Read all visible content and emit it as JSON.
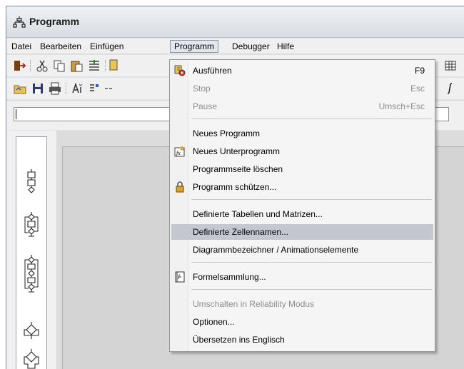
{
  "window": {
    "title": "Programm"
  },
  "menubar": {
    "items": [
      {
        "label": "Datei"
      },
      {
        "label": "Bearbeiten"
      },
      {
        "label": "Einfügen"
      },
      {
        "label": "Programm"
      },
      {
        "label": "Debugger"
      },
      {
        "label": "Hilfe"
      }
    ]
  },
  "menu": {
    "open_menu": "Programm",
    "items": [
      {
        "label": "Ausführen",
        "shortcut": "F9",
        "icon": "run-icon",
        "enabled": true
      },
      {
        "label": "Stop",
        "shortcut": "Esc",
        "enabled": false
      },
      {
        "label": "Pause",
        "shortcut": "Umsch+Esc",
        "enabled": false
      },
      {
        "label": "Neues Programm",
        "enabled": true
      },
      {
        "label": "Neues Unterprogramm",
        "icon": "fx-icon",
        "enabled": true
      },
      {
        "label": "Programmseite löschen",
        "enabled": true
      },
      {
        "label": "Programm schützen...",
        "icon": "lock-icon",
        "enabled": true
      },
      {
        "label": "Definierte Tabellen und Matrizen...",
        "enabled": true
      },
      {
        "label": "Definierte Zellennamen...",
        "enabled": true,
        "highlighted": true
      },
      {
        "label": "Diagrammbezeichner / Animationselemente",
        "enabled": true
      },
      {
        "label": "Formelsammlung...",
        "icon": "formula-book-icon",
        "enabled": true
      },
      {
        "label": "Umschalten in Reliability Modus",
        "enabled": false
      },
      {
        "label": "Optionen...",
        "enabled": true
      },
      {
        "label": "Übersetzen ins Englisch",
        "enabled": true
      }
    ]
  },
  "colors": {
    "menu_highlight": "#c3c7d0",
    "disabled_text": "#8e8e8e",
    "menu_background": "#f5f5f5"
  }
}
